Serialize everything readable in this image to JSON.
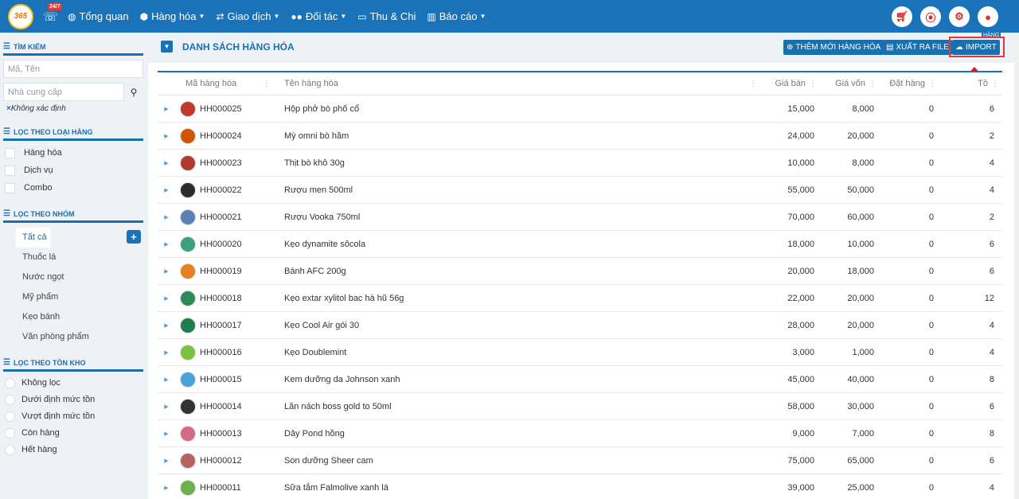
{
  "nav": {
    "logo_text": "365",
    "hotline_badge": "24/7",
    "items": [
      {
        "label": "Tổng quan",
        "icon": "dashboard-icon"
      },
      {
        "label": "Hàng hóa",
        "icon": "cubes-icon"
      },
      {
        "label": "Giao dịch",
        "icon": "exchange-icon"
      },
      {
        "label": "Đối tác",
        "icon": "users-icon"
      },
      {
        "label": "Thu & Chi",
        "icon": "money-icon"
      },
      {
        "label": "Báo cáo",
        "icon": "bar-chart-icon"
      }
    ]
  },
  "sidebar": {
    "search_title": "TÌM KIẾM",
    "search_placeholder": "Mã, Tên",
    "supplier_placeholder": "Nhà cung cấp",
    "unknown_label": "Không xác định",
    "type_title": "LỌC THEO LOẠI HÀNG",
    "types": [
      "Hàng hóa",
      "Dịch vụ",
      "Combo"
    ],
    "group_title": "LỌC THEO NHÓM",
    "groups": [
      "Tất cả",
      "Thuốc lá",
      "Nước ngọt",
      "Mỹ phẩm",
      "Kẹo bánh",
      "Văn phòng phẩm"
    ],
    "stock_title": "LỌC THEO TỒN KHO",
    "stock": [
      "Không lọc",
      "Dưới định mức tồn",
      "Vượt định mức tồn",
      "Còn hàng",
      "Hết hàng"
    ]
  },
  "main": {
    "title": "DANH SÁCH HÀNG HÓA",
    "add_label": "THÊM MỚI HÀNG HÓA",
    "export_label": "XUẤT RA FILE",
    "import_label": "IMPORT",
    "overflow_label": "HÀNG"
  },
  "table": {
    "headers": [
      "Mã hàng hóa",
      "Tên hàng hóa",
      "Giá bán",
      "Giá vốn",
      "Đặt hàng",
      "Tồ"
    ],
    "rows": [
      {
        "code": "HH000025",
        "name": "Hộp phở bò phố cổ",
        "price": "15,000",
        "cost": "8,000",
        "ordered": "0",
        "stock": "6",
        "color": "#c0392b"
      },
      {
        "code": "HH000024",
        "name": "Mỳ omni bò hầm",
        "price": "24,000",
        "cost": "20,000",
        "ordered": "0",
        "stock": "2",
        "color": "#d35400"
      },
      {
        "code": "HH000023",
        "name": "Thịt bò khô 30g",
        "price": "10,000",
        "cost": "8,000",
        "ordered": "0",
        "stock": "4",
        "color": "#b03a2e"
      },
      {
        "code": "HH000022",
        "name": "Rượu men 500ml",
        "price": "55,000",
        "cost": "50,000",
        "ordered": "0",
        "stock": "4",
        "color": "#2c2c2c"
      },
      {
        "code": "HH000021",
        "name": "Rượu Vooka 750ml",
        "price": "70,000",
        "cost": "60,000",
        "ordered": "0",
        "stock": "2",
        "color": "#5d7fb8"
      },
      {
        "code": "HH000020",
        "name": "Kẹo dynamite sôcola",
        "price": "18,000",
        "cost": "10,000",
        "ordered": "0",
        "stock": "6",
        "color": "#3aa17e"
      },
      {
        "code": "HH000019",
        "name": "Bánh AFC 200g",
        "price": "20,000",
        "cost": "18,000",
        "ordered": "0",
        "stock": "6",
        "color": "#e67e22"
      },
      {
        "code": "HH000018",
        "name": "Kẹo extar xylitol bac hà hũ 56g",
        "price": "22,000",
        "cost": "20,000",
        "ordered": "0",
        "stock": "12",
        "color": "#2e8b57"
      },
      {
        "code": "HH000017",
        "name": "Kẹo Cool Air gói 30",
        "price": "28,000",
        "cost": "20,000",
        "ordered": "0",
        "stock": "4",
        "color": "#1e7d4b"
      },
      {
        "code": "HH000016",
        "name": "Kẹo Doublemint",
        "price": "3,000",
        "cost": "1,000",
        "ordered": "0",
        "stock": "4",
        "color": "#7cc242"
      },
      {
        "code": "HH000015",
        "name": "Kem dưỡng da Johnson xanh",
        "price": "45,000",
        "cost": "40,000",
        "ordered": "0",
        "stock": "8",
        "color": "#4aa3d8"
      },
      {
        "code": "HH000014",
        "name": "Lăn nách boss gold to 50ml",
        "price": "58,000",
        "cost": "30,000",
        "ordered": "0",
        "stock": "6",
        "color": "#333333"
      },
      {
        "code": "HH000013",
        "name": "Dây Pond hồng",
        "price": "9,000",
        "cost": "7,000",
        "ordered": "0",
        "stock": "8",
        "color": "#d46a86"
      },
      {
        "code": "HH000012",
        "name": "Son dưỡng Sheer cam",
        "price": "75,000",
        "cost": "65,000",
        "ordered": "0",
        "stock": "6",
        "color": "#b5655d"
      },
      {
        "code": "HH000011",
        "name": "Sữa tắm Falmolive xanh lá",
        "price": "39,000",
        "cost": "25,000",
        "ordered": "0",
        "stock": "4",
        "color": "#6ab04c"
      }
    ]
  }
}
